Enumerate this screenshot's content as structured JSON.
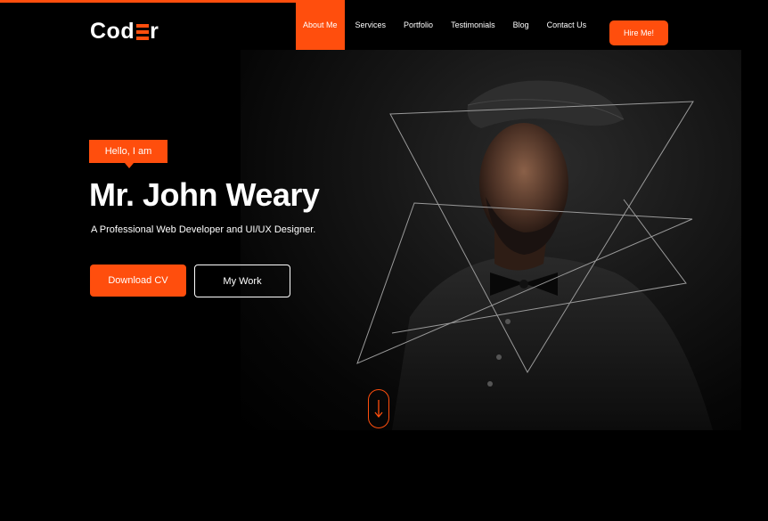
{
  "brand": {
    "logo_prefix": "Cod",
    "logo_suffix": "r",
    "accent_color": "#ff4e0d"
  },
  "nav": {
    "items": [
      {
        "label": "About Me",
        "active": true
      },
      {
        "label": "Services",
        "active": false
      },
      {
        "label": "Portfolio",
        "active": false
      },
      {
        "label": "Testimonials",
        "active": false
      },
      {
        "label": "Blog",
        "active": false
      },
      {
        "label": "Contact Us",
        "active": false
      }
    ],
    "cta_label": "Hire Me!"
  },
  "hero": {
    "badge": "Hello, I am",
    "name": "Mr. John Weary",
    "tagline": "A Professional Web Developer and UI/UX Designer.",
    "primary_button": "Download CV",
    "secondary_button": "My Work",
    "scroll_icon": "arrow-down-icon"
  }
}
